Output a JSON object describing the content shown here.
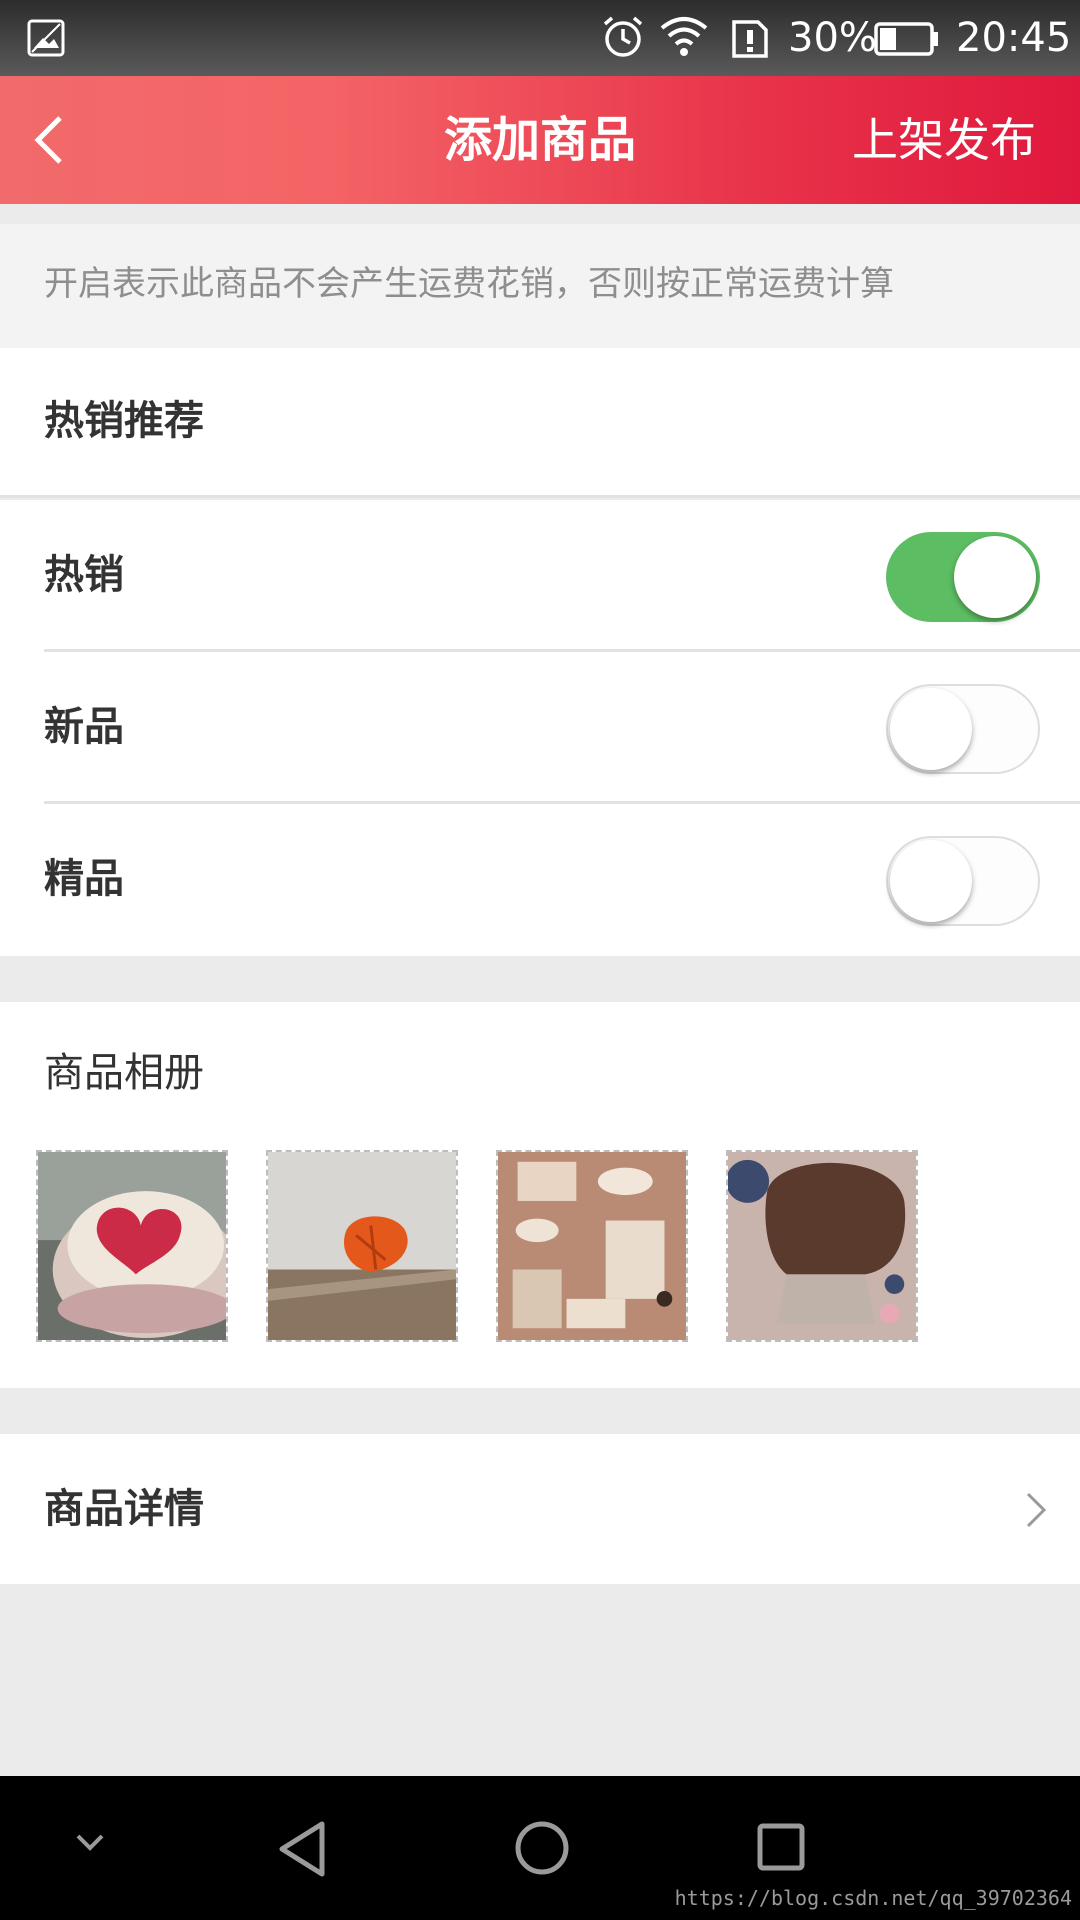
{
  "status_bar": {
    "battery_percent": "30%",
    "time": "20:45",
    "icons": [
      "gallery-icon",
      "alarm-icon",
      "wifi-icon",
      "sim-icon",
      "battery-icon"
    ]
  },
  "app_bar": {
    "title": "添加商品",
    "action_label": "上架发布",
    "back_icon": "chevron-left-icon"
  },
  "notice": {
    "text": "开启表示此商品不会产生运费花销，否则按正常运费计算"
  },
  "hot_section": {
    "header": "热销推荐",
    "toggles": [
      {
        "label": "热销",
        "on": true
      },
      {
        "label": "新品",
        "on": false
      },
      {
        "label": "精品",
        "on": false
      }
    ]
  },
  "album": {
    "label": "商品相册",
    "images": [
      "heart-cupcake-photo",
      "physalis-photo",
      "cafe-illustration-photo",
      "chocolate-muffin-photo"
    ]
  },
  "detail": {
    "label": "商品详情",
    "icon": "chevron-right-icon"
  },
  "nav_bar": {
    "icons": [
      "chevron-down-icon",
      "back-triangle-icon",
      "home-circle-icon",
      "recent-square-icon"
    ]
  },
  "watermark": "https://blog.csdn.net/qq_39702364",
  "colors": {
    "app_bar_start": "#f26a6b",
    "app_bar_end": "#e0183d",
    "toggle_on": "#5cbd62"
  }
}
